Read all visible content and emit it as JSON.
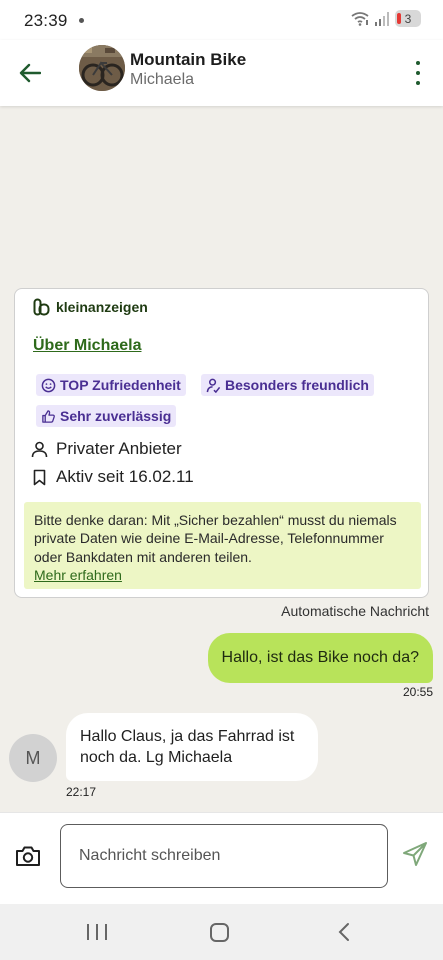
{
  "status_bar": {
    "time": "23:39",
    "battery_level": "3"
  },
  "header": {
    "title": "Mountain Bike",
    "subtitle": "Michaela"
  },
  "info_card": {
    "brand": "kleinanzeigen",
    "about_link": "Über Michaela",
    "badges": [
      {
        "label": "TOP Zufriedenheit",
        "icon": "smiley-icon"
      },
      {
        "label": "Besonders freundlich",
        "icon": "friendly-person-icon"
      },
      {
        "label": "Sehr zuverlässig",
        "icon": "thumbs-up-icon"
      }
    ],
    "seller_type": "Privater Anbieter",
    "active_since": "Aktiv seit 16.02.11",
    "notice_text": "Bitte denke daran: Mit „Sicher bezahlen“ musst du niemals private Daten wie deine E-Mail-Adresse, Telefonnummer oder Bankdaten mit anderen teilen.",
    "notice_link": "Mehr erfahren"
  },
  "automatic_label": "Automatische Nachricht",
  "messages": [
    {
      "direction": "outgoing",
      "text": "Hallo, ist das Bike noch da?",
      "time": "20:55"
    },
    {
      "direction": "incoming",
      "text": "Hallo Claus, ja das Fahrrad ist noch da. Lg Michaela",
      "time": "22:17",
      "avatar_initial": "M"
    }
  ],
  "composer": {
    "placeholder": "Nachricht schreiben"
  },
  "colors": {
    "accent_green": "#2e6a1b",
    "outgoing_bubble": "#b8e35a",
    "badge_bg": "#ece7fb",
    "badge_text": "#4a2f93",
    "notice_bg": "#edf6c5",
    "chat_bg": "#f1efea"
  }
}
